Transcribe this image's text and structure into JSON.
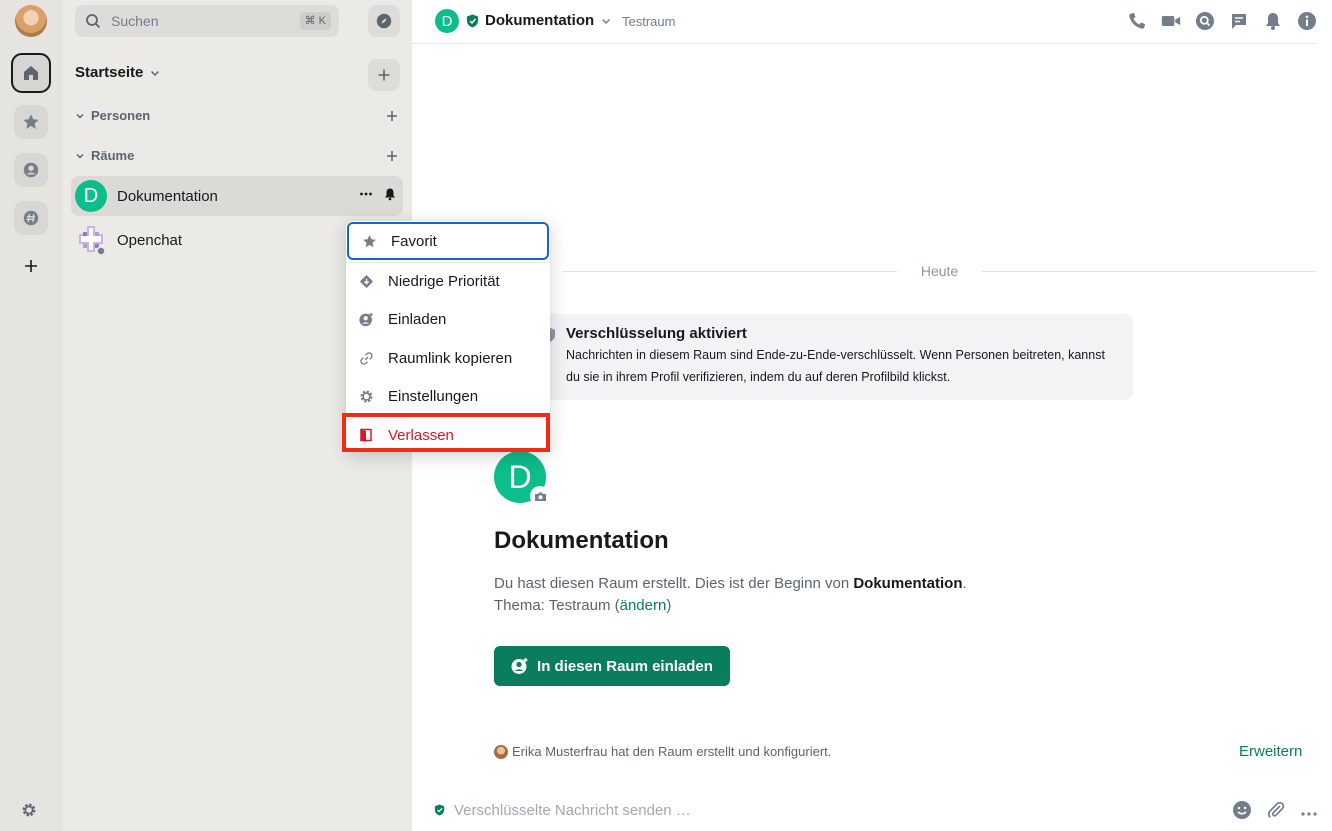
{
  "spacebar": {
    "items": [
      "Startseite",
      "Favoriten",
      "Personen",
      "Räume",
      "Raum erstellen",
      "Einstellungen"
    ]
  },
  "roomlist": {
    "search_label": "Suchen",
    "search_shortcut": "⌘ K",
    "home_title": "Startseite",
    "sections": [
      {
        "label": "Personen"
      },
      {
        "label": "Räume"
      }
    ],
    "rooms": [
      {
        "name": "Dokumentation",
        "initial": "D",
        "selected": true
      },
      {
        "name": "Openchat",
        "initial": "",
        "selected": false
      }
    ]
  },
  "header": {
    "avatar_initial": "D",
    "room_name": "Dokumentation",
    "topic": "Testraum"
  },
  "timeline": {
    "day_separator": "Heute",
    "encryption_title": "Verschlüsselung aktiviert",
    "encryption_text": "Nachrichten in diesem Raum sind Ende-zu-Ende-verschlüsselt. Wenn Personen beitreten, kannst du sie in ihrem Profil verifizieren, indem du auf deren Profilbild klickst.",
    "room_avatar_initial": "D",
    "room_title": "Dokumentation",
    "intro_prefix": "Du hast diesen Raum erstellt. Dies ist der Beginn von ",
    "intro_room": "Dokumentation",
    "intro_suffix": ".",
    "topic_prefix": "Thema: Testraum (",
    "topic_link": "ändern",
    "topic_suffix": ")",
    "invite_button": "In diesen Raum einladen",
    "created_summary": "Erika Musterfrau hat den Raum erstellt und konfiguriert.",
    "expand_link": "Erweitern"
  },
  "composer": {
    "placeholder": "Verschlüsselte Nachricht senden …"
  },
  "context_menu": {
    "items": [
      {
        "label": "Favorit",
        "icon": "star-icon"
      },
      {
        "label": "Niedrige Priorität",
        "icon": "low-priority-icon"
      },
      {
        "label": "Einladen",
        "icon": "invite-icon"
      },
      {
        "label": "Raumlink kopieren",
        "icon": "link-icon"
      },
      {
        "label": "Einstellungen",
        "icon": "settings-icon"
      },
      {
        "label": "Verlassen",
        "icon": "leave-icon"
      }
    ]
  },
  "colors": {
    "accent": "#0a7d5f",
    "room_avatar": "#0dbd8b",
    "danger": "#d51928",
    "highlight_box": "#f02d13",
    "focus_ring": "#1c64c4"
  }
}
